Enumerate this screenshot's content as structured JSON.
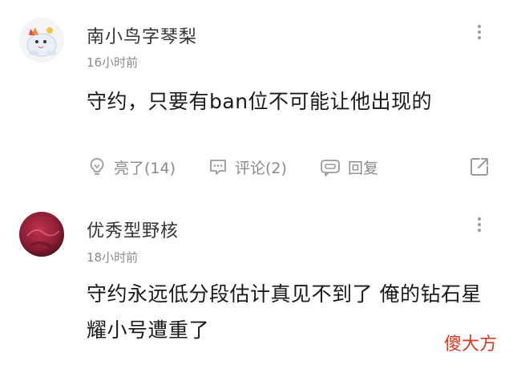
{
  "comments": [
    {
      "username": "南小鸟字琴梨",
      "time": "16小时前",
      "text": "守约，只要有ban位不可能让他出现的",
      "actions": {
        "like_label": "亮了(14)",
        "comment_label": "评论(2)",
        "reply_label": "回复"
      }
    },
    {
      "username": "优秀型野核",
      "time": "18小时前",
      "text": "守约永远低分段估计真见不到了 俺的钻石星耀小号遭重了"
    }
  ],
  "watermark": "傻大方",
  "colors": {
    "accent_watermark": "#d63a1f",
    "secondary_text": "#8a8a8a",
    "icon_gray": "#9a9a9a"
  },
  "icons": {
    "more": "vertical-dots-icon",
    "like": "lightbulb-icon",
    "comment": "chat-bubble-icon",
    "reply": "reply-bubble-icon",
    "share": "share-arrow-icon"
  }
}
